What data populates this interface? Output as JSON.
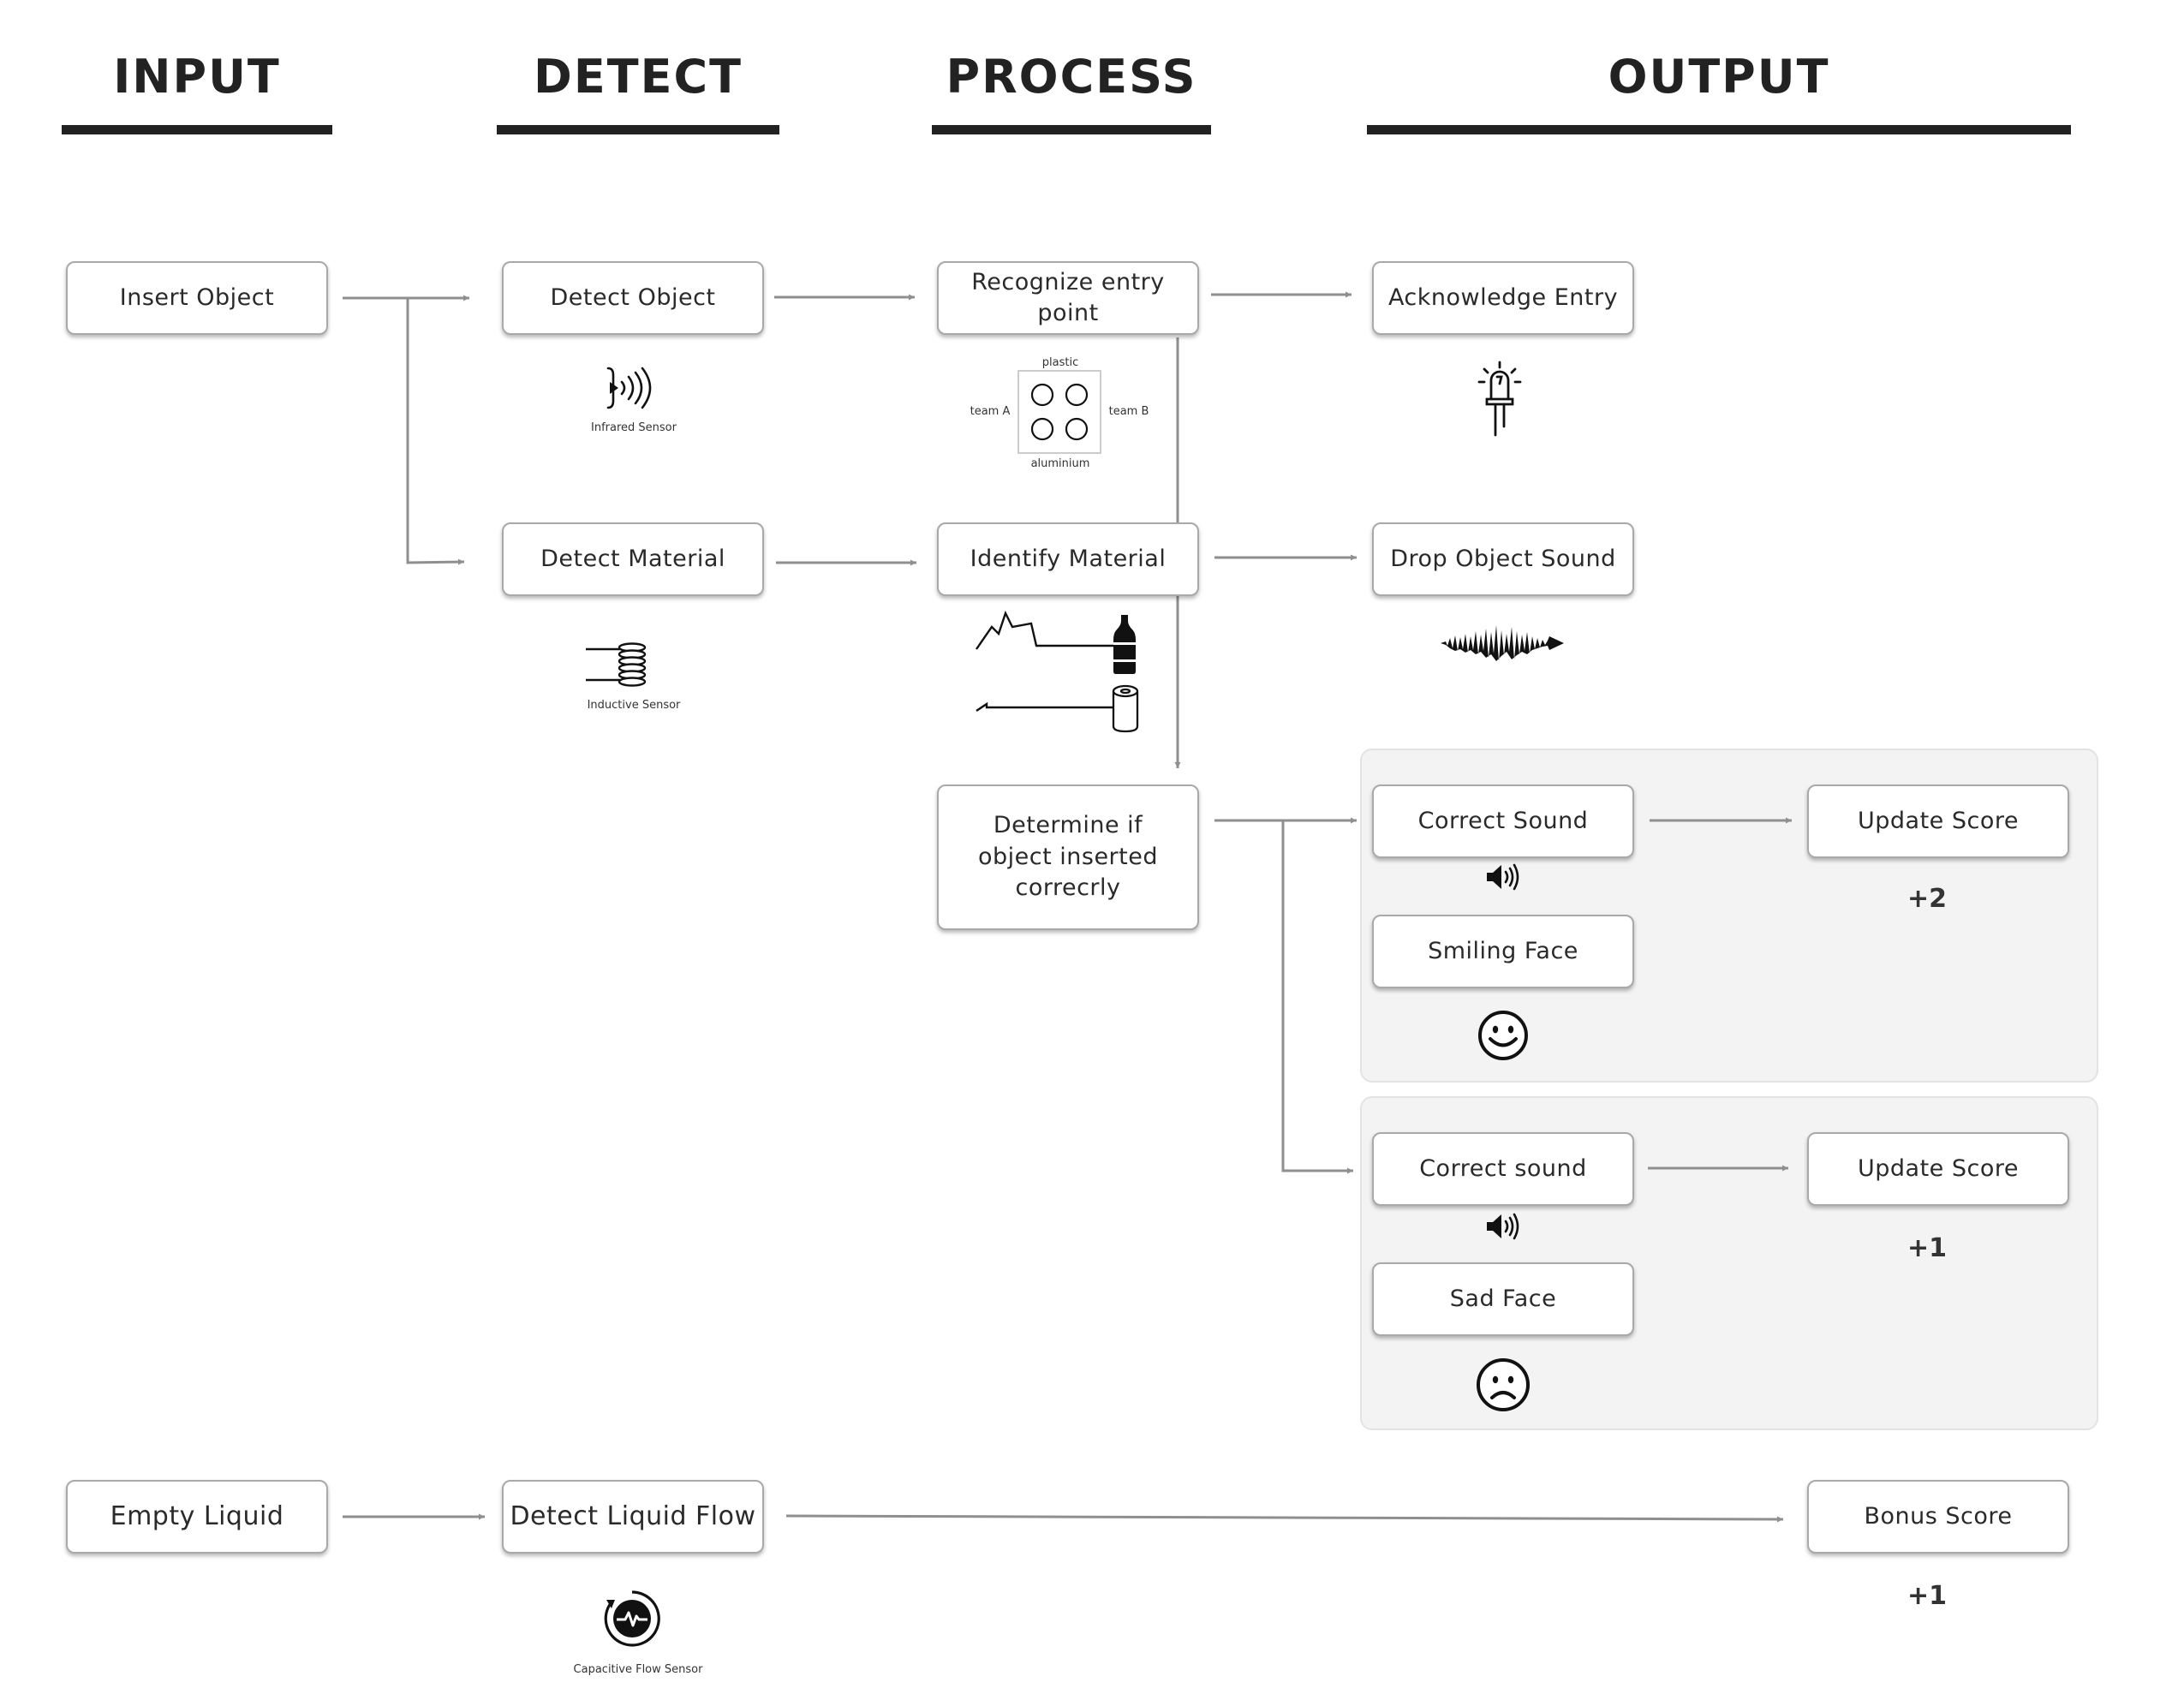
{
  "columns": {
    "input": "INPUT",
    "detect": "DETECT",
    "process": "PROCESS",
    "output": "OUTPUT"
  },
  "nodes": {
    "insert_object": "Insert Object",
    "detect_object": "Detect Object",
    "recognize_entry": "Recognize entry point",
    "acknowledge_entry": "Acknowledge Entry",
    "detect_material": "Detect Material",
    "identify_material": "Identify Material",
    "drop_object_sound": "Drop Object Sound",
    "determine_correct": "Determine if  object inserted correcrly",
    "correct_sound_1": "Correct Sound",
    "update_score_1": "Update Score",
    "smiling_face": "Smiling Face",
    "correct_sound_2": "Correct sound",
    "update_score_2": "Update Score",
    "sad_face": "Sad Face",
    "empty_liquid": "Empty Liquid",
    "detect_liquid_flow": "Detect Liquid Flow",
    "bonus_score": "Bonus Score"
  },
  "labels": {
    "infrared_sensor": "Infrared Sensor",
    "inductive_sensor": "Inductive Sensor",
    "capacitive_flow_sensor": "Capacitive Flow Sensor",
    "bin_plastic": "plastic",
    "bin_aluminium": "aluminium",
    "bin_team_a": "team A",
    "bin_team_b": "team B"
  },
  "scores": {
    "correct": "+2",
    "incorrect": "+1",
    "bonus": "+1"
  },
  "icons": [
    "infrared-sensor-icon",
    "inductive-coil-icon",
    "capacitive-flow-sensor-icon",
    "bin-slots-diagram",
    "led-light-icon",
    "sound-waveform-icon",
    "plastic-bottle-icon",
    "aluminium-can-icon",
    "speaker-icon",
    "smiling-face-icon",
    "sad-face-icon"
  ],
  "colors": {
    "connector": "#8f8f8f",
    "group_background": "#f3f3f3",
    "title_rule": "#222222"
  }
}
